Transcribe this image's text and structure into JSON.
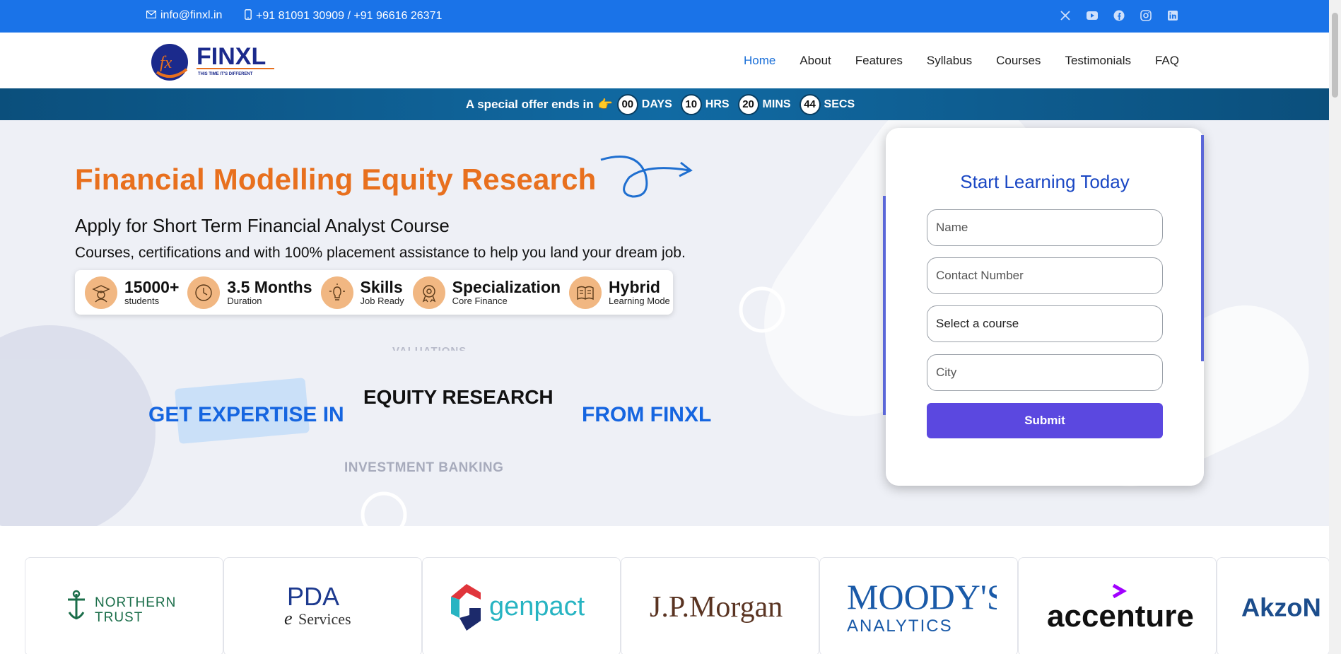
{
  "topbar": {
    "email": "info@finxl.in",
    "phone": "+91 81091 30909 / +91 96616 26371",
    "socials": [
      "x-icon",
      "youtube-icon",
      "facebook-icon",
      "instagram-icon",
      "linkedin-icon"
    ]
  },
  "brand": {
    "name": "FINXL",
    "tagline": "THIS TIME IT'S DIFFERENT",
    "mark": "fx"
  },
  "nav": {
    "items": [
      "Home",
      "About",
      "Features",
      "Syllabus",
      "Courses",
      "Testimonials",
      "FAQ"
    ],
    "active": "Home"
  },
  "offer": {
    "prefix": "A special offer ends in",
    "days": "00",
    "days_label": "DAYS",
    "hrs": "10",
    "hrs_label": "HRS",
    "mins": "20",
    "mins_label": "MINS",
    "secs": "44",
    "secs_label": "SECS"
  },
  "hero": {
    "title": "Financial Modelling Equity Research",
    "subtitle": "Apply for Short Term Financial Analyst Course",
    "description": "Courses, certifications and with 100% placement assistance to help you land your dream job.",
    "stats": [
      {
        "value": "15000+",
        "caption": "students",
        "icon": "graduate-icon"
      },
      {
        "value": "3.5 Months",
        "caption": "Duration",
        "icon": "clock-icon"
      },
      {
        "value": "Skills",
        "caption": "Job Ready",
        "icon": "bulb-icon"
      },
      {
        "value": "Specialization",
        "caption": "Core Finance",
        "icon": "award-icon"
      },
      {
        "value": "Hybrid",
        "caption": "Learning Mode",
        "icon": "book-icon"
      }
    ],
    "rotator_prev": "VALUATIONS",
    "lead": "GET EXPERTISE IN",
    "current": "EQUITY RESEARCH",
    "trail": "FROM FINXL",
    "rotator_next": "INVESTMENT BANKING"
  },
  "form": {
    "title": "Start Learning Today",
    "name_placeholder": "Name",
    "contact_placeholder": "Contact Number",
    "course_select": "Select a course",
    "city_placeholder": "City",
    "submit_label": "Submit"
  },
  "partners": [
    "NORTHERN TRUST",
    "PDA e Services",
    "genpact",
    "J.P.Morgan",
    "MOODY'S ANALYTICS",
    "accenture",
    "AkzoN"
  ],
  "colors": {
    "topbar": "#1a73e8",
    "accent_orange": "#e8701e",
    "accent_blue": "#1565e0",
    "submit": "#5b48e0"
  }
}
